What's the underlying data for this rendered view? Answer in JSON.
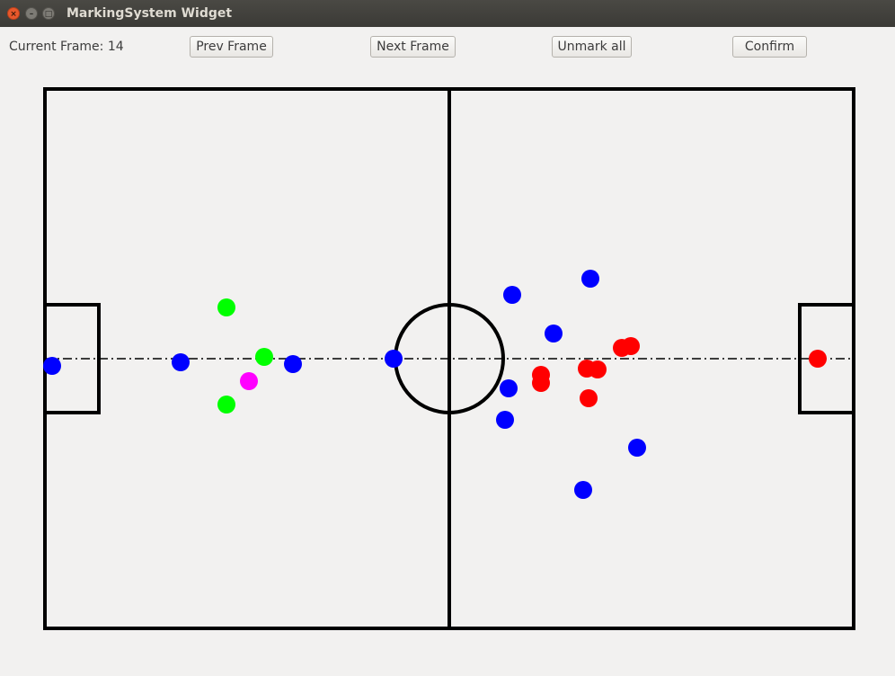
{
  "window": {
    "title": "MarkingSystem Widget",
    "controls": {
      "close_glyph": "×",
      "minimize_glyph": "–",
      "maximize_glyph": "□"
    }
  },
  "toolbar": {
    "frame_label": "Current Frame: 14",
    "prev_label": "Prev Frame",
    "next_label": "Next Frame",
    "unmark_label": "Unmark all",
    "confirm_label": "Confirm"
  },
  "colors": {
    "background": "#f2f1f0",
    "lines": "#000000",
    "blue_player": "#0000ff",
    "red_player": "#ff0000",
    "green_player": "#00ff00",
    "magenta_player": "#ff00ff"
  },
  "pitch": {
    "markings": [
      "outer-boundary",
      "halfway-line",
      "center-circle",
      "left-goal-box",
      "right-goal-box",
      "center-axis-dashdot"
    ]
  },
  "players": [
    {
      "id": "b1",
      "color": "blue"
    },
    {
      "id": "b2",
      "color": "blue"
    },
    {
      "id": "b3",
      "color": "blue"
    },
    {
      "id": "b4",
      "color": "blue"
    },
    {
      "id": "b5",
      "color": "blue"
    },
    {
      "id": "b6",
      "color": "blue"
    },
    {
      "id": "b7",
      "color": "blue"
    },
    {
      "id": "b8",
      "color": "blue"
    },
    {
      "id": "b9",
      "color": "blue"
    },
    {
      "id": "b10",
      "color": "blue"
    },
    {
      "id": "b11",
      "color": "blue"
    },
    {
      "id": "b12",
      "color": "blue"
    },
    {
      "id": "g1",
      "color": "green"
    },
    {
      "id": "g2",
      "color": "green"
    },
    {
      "id": "g3",
      "color": "green"
    },
    {
      "id": "m1",
      "color": "magenta"
    },
    {
      "id": "r1",
      "color": "red"
    },
    {
      "id": "r2",
      "color": "red"
    },
    {
      "id": "r3",
      "color": "red"
    },
    {
      "id": "r4",
      "color": "red"
    },
    {
      "id": "r5",
      "color": "red"
    },
    {
      "id": "r6",
      "color": "red"
    },
    {
      "id": "r7",
      "color": "red"
    },
    {
      "id": "r8",
      "color": "red"
    },
    {
      "id": "r9",
      "color": "red"
    }
  ]
}
